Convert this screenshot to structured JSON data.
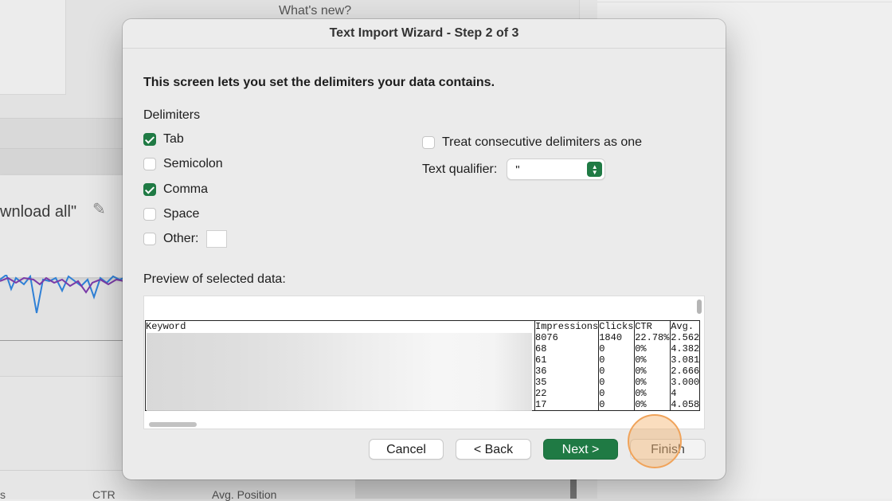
{
  "background": {
    "whats_new": "What's new?",
    "download_text": "wnload all\"",
    "pencil_icon": "pencil-icon",
    "footer_columns": [
      "s",
      "CTR",
      "Avg. Position"
    ]
  },
  "dialog": {
    "title": "Text Import Wizard - Step 2 of 3",
    "instruction": "This screen lets you set the delimiters your data contains.",
    "delimiters_label": "Delimiters",
    "delimiters": [
      {
        "label": "Tab",
        "checked": true
      },
      {
        "label": "Semicolon",
        "checked": false
      },
      {
        "label": "Comma",
        "checked": true
      },
      {
        "label": "Space",
        "checked": false
      },
      {
        "label": "Other:",
        "checked": false
      }
    ],
    "other_value": "",
    "treat_consecutive": {
      "label": "Treat consecutive delimiters as one",
      "checked": false
    },
    "text_qualifier": {
      "label": "Text qualifier:",
      "value": "\""
    },
    "preview_label": "Preview of selected data:",
    "preview": {
      "headers": [
        "Keyword",
        "Impressions",
        "Clicks",
        "CTR",
        "Avg."
      ],
      "rows": [
        [
          "",
          "8076",
          "1840",
          "22.78%",
          "2.562"
        ],
        [
          "",
          "68",
          "0",
          "0%",
          "4.382"
        ],
        [
          "",
          "61",
          "0",
          "0%",
          "3.081"
        ],
        [
          "",
          "36",
          "0",
          "0%",
          "2.666"
        ],
        [
          "",
          "35",
          "0",
          "0%",
          "3.000"
        ],
        [
          "",
          "22",
          "0",
          "0%",
          "4"
        ],
        [
          "",
          "17",
          "0",
          "0%",
          "4.058"
        ]
      ]
    },
    "buttons": {
      "cancel": "Cancel",
      "back": "< Back",
      "next": "Next >",
      "finish": "Finish"
    }
  },
  "colors": {
    "accent": "#1f7a44",
    "click_highlight": "#f0a35a"
  }
}
